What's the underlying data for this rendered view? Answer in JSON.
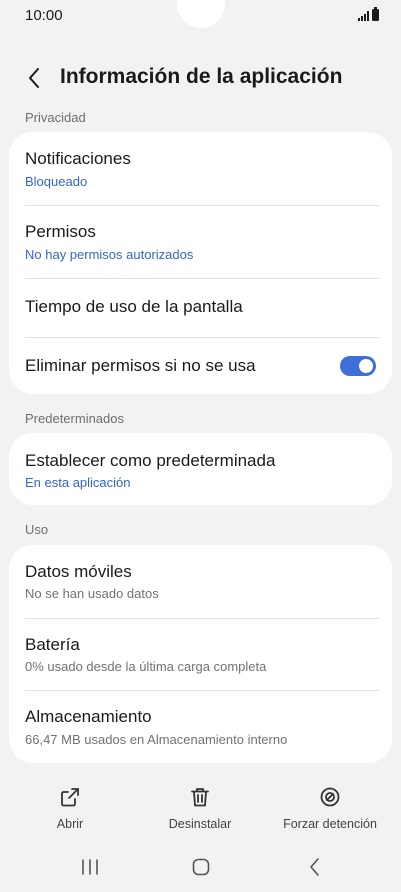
{
  "status_bar": {
    "time": "10:00"
  },
  "header": {
    "title": "Información de la aplicación"
  },
  "sections": {
    "privacy": {
      "label": "Privacidad",
      "notifications": {
        "title": "Notificaciones",
        "subtitle": "Bloqueado"
      },
      "permissions": {
        "title": "Permisos",
        "subtitle": "No hay permisos autorizados"
      },
      "screen_time": {
        "title": "Tiempo de uso de la pantalla"
      },
      "remove_permissions": {
        "title": "Eliminar permisos si no se usa",
        "enabled": true
      }
    },
    "defaults": {
      "label": "Predeterminados",
      "set_default": {
        "title": "Establecer como predeterminada",
        "subtitle": "En esta aplicación"
      }
    },
    "usage": {
      "label": "Uso",
      "mobile_data": {
        "title": "Datos móviles",
        "subtitle": "No se han usado datos"
      },
      "battery": {
        "title": "Batería",
        "subtitle": "0% usado desde la última carga completa"
      },
      "storage": {
        "title": "Almacenamiento",
        "subtitle": "66,47 MB usados en Almacenamiento interno"
      }
    }
  },
  "actions": {
    "open": {
      "label": "Abrir",
      "icon": "open-external-icon"
    },
    "uninstall": {
      "label": "Desinstalar",
      "icon": "trash-icon"
    },
    "force_stop": {
      "label": "Forzar detención",
      "icon": "stop-icon"
    }
  },
  "nav": {
    "recents_icon": "recents-icon",
    "home_icon": "home-icon",
    "back_icon": "back-icon"
  },
  "colors": {
    "accent": "#3e6fd9",
    "link": "#3466c9",
    "background": "#f2f2f4",
    "card": "#ffffff"
  }
}
